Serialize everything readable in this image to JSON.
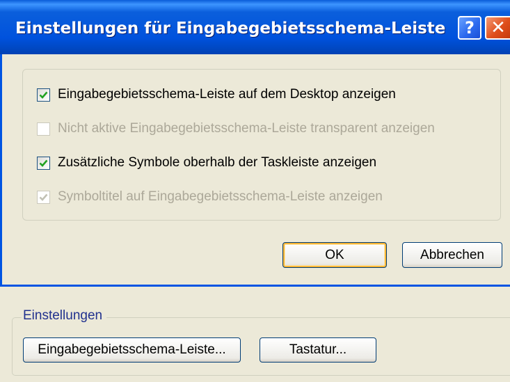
{
  "dialog": {
    "title": "Einstellungen für Eingabegebietsschema-Leiste",
    "help_glyph": "?",
    "close_glyph": "✕",
    "options": [
      {
        "label": "Eingabegebietsschema-Leiste auf dem Desktop anzeigen",
        "checked": true,
        "enabled": true
      },
      {
        "label": "Nicht aktive Eingabegebietsschema-Leiste transparent anzeigen",
        "checked": false,
        "enabled": false
      },
      {
        "label": "Zusätzliche Symbole oberhalb der Taskleiste anzeigen",
        "checked": true,
        "enabled": true
      },
      {
        "label": "Symboltitel auf Eingabegebietsschema-Leiste anzeigen",
        "checked": true,
        "enabled": false
      }
    ],
    "ok_label": "OK",
    "cancel_label": "Abbrechen"
  },
  "parent": {
    "group_label": "Einstellungen",
    "buttons": [
      {
        "label": "Eingabegebietsschema-Leiste..."
      },
      {
        "label": "Tastatur..."
      }
    ]
  },
  "colors": {
    "titlebar": "#0054e3",
    "dialog_face": "#ece9d8",
    "check_enabled": "#21a121",
    "text_disabled": "#aca899",
    "groupbox_label": "#21318e",
    "close_button": "#e04f1c"
  }
}
